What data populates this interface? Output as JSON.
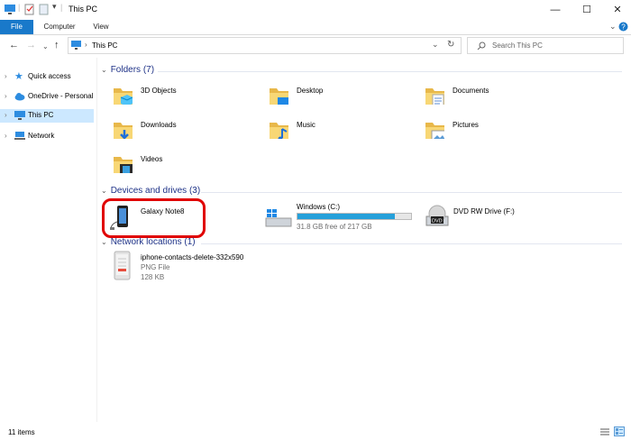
{
  "window": {
    "title": "This PC"
  },
  "ribbon": {
    "tabs": [
      "File",
      "Computer",
      "View"
    ]
  },
  "address": {
    "crumb": "This PC"
  },
  "search": {
    "placeholder": "Search This PC"
  },
  "sidebar": {
    "items": [
      {
        "label": "Quick access",
        "icon": "star-icon"
      },
      {
        "label": "OneDrive - Personal",
        "icon": "cloud-icon"
      },
      {
        "label": "This PC",
        "icon": "computer-icon",
        "selected": true
      },
      {
        "label": "Network",
        "icon": "network-icon"
      }
    ]
  },
  "groups": {
    "folders": {
      "header": "Folders (7)",
      "items": [
        "3D Objects",
        "Desktop",
        "Documents",
        "Downloads",
        "Music",
        "Pictures",
        "Videos"
      ]
    },
    "devices": {
      "header": "Devices and drives (3)",
      "items": [
        {
          "name": "Galaxy Note8",
          "icon": "phone-icon",
          "highlighted": true
        },
        {
          "name": "Windows (C:)",
          "icon": "windows-drive-icon",
          "free_text": "31.8 GB free of 217 GB",
          "used_fraction": 0.854
        },
        {
          "name": "DVD RW Drive (F:)",
          "icon": "dvd-drive-icon"
        }
      ]
    },
    "network": {
      "header": "Network locations (1)",
      "items": [
        {
          "name": "iphone-contacts-delete-332x590",
          "type": "PNG File",
          "size": "128 KB"
        }
      ]
    }
  },
  "status": {
    "text": "11 items"
  },
  "colors": {
    "accent": "#1979ca",
    "highlight_ring": "#e00000",
    "drive_bar": "#26a0da",
    "folder": "#f8d775"
  }
}
